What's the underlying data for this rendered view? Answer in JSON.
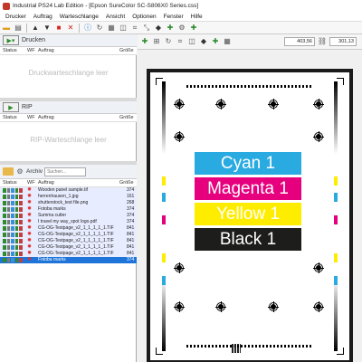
{
  "window": {
    "title": "Industrial PS24 Lab Edition - [Epson SureColor SC-S806X0 Series.css]"
  },
  "menu": [
    "Drucker",
    "Auftrag",
    "Warteschlange",
    "Ansicht",
    "Optionen",
    "Fenster",
    "Hilfe"
  ],
  "toolbar_icons": [
    "open-folder-icon",
    "save-icon",
    "arrow-up-icon",
    "arrow-down-icon",
    "stop-icon",
    "delete-icon",
    "info-icon",
    "rotate-icon",
    "grid-icon",
    "layers-icon",
    "crop-icon",
    "transform-icon",
    "place-icon",
    "add-icon",
    "settings-icon",
    "add-icon"
  ],
  "queues": {
    "print": {
      "label": "Drucken",
      "empty": "Druckwarteschlange leer"
    },
    "rip": {
      "label": "RIP",
      "empty": "RIP-Warteschlange leer"
    }
  },
  "columns": {
    "status": "Status",
    "wf": "WF",
    "name": "Auftrag",
    "size": "Größe"
  },
  "archive": {
    "label": "Archiv",
    "search_placeholder": "Suchen..."
  },
  "jobs": [
    {
      "name": "Wooden panel sample.tif",
      "size": "374",
      "selected": false
    },
    {
      "name": "herrenhausen_1.jpg",
      "size": "161",
      "selected": false
    },
    {
      "name": "shutterstock_test file.png",
      "size": "268",
      "selected": false
    },
    {
      "name": "Fotoba marks",
      "size": "374",
      "selected": false
    },
    {
      "name": "Summa cutter",
      "size": "374",
      "selected": false
    },
    {
      "name": "I travel my way_spot logo.pdf",
      "size": "374",
      "selected": false
    },
    {
      "name": "CG-OG-Testpage_v2_1_1_1_1_1.TIF",
      "size": "841",
      "selected": false
    },
    {
      "name": "CG-OG-Testpage_v2_1_1_1_1_1.TIF",
      "size": "841",
      "selected": false
    },
    {
      "name": "CG-OG-Testpage_v2_1_1_1_1_1.TIF",
      "size": "841",
      "selected": false
    },
    {
      "name": "CG-OG-Testpage_v2_1_1_1_1_1.TIF",
      "size": "841",
      "selected": false
    },
    {
      "name": "CG-OG-Testpage_v2_1_1_1_1_1.TIF",
      "size": "841",
      "selected": false
    },
    {
      "name": "Fotoba marks",
      "size": "374",
      "selected": true
    }
  ],
  "preview": {
    "x": "403,56",
    "y": "301,13",
    "labels": [
      {
        "text": "Cyan 1",
        "bg": "#29aae1",
        "fg": "#ffffff"
      },
      {
        "text": "Magenta 1",
        "bg": "#e6007e",
        "fg": "#ffffff"
      },
      {
        "text": "Yellow 1",
        "bg": "#ffed00",
        "fg": "#ffffff"
      },
      {
        "text": "Black 1",
        "bg": "#1d1d1b",
        "fg": "#ffffff"
      }
    ]
  },
  "colors": {
    "accent": "#1e74d8",
    "cyan": "#29aae1",
    "magenta": "#e6007e",
    "yellow": "#ffed00",
    "black": "#1d1d1b"
  }
}
